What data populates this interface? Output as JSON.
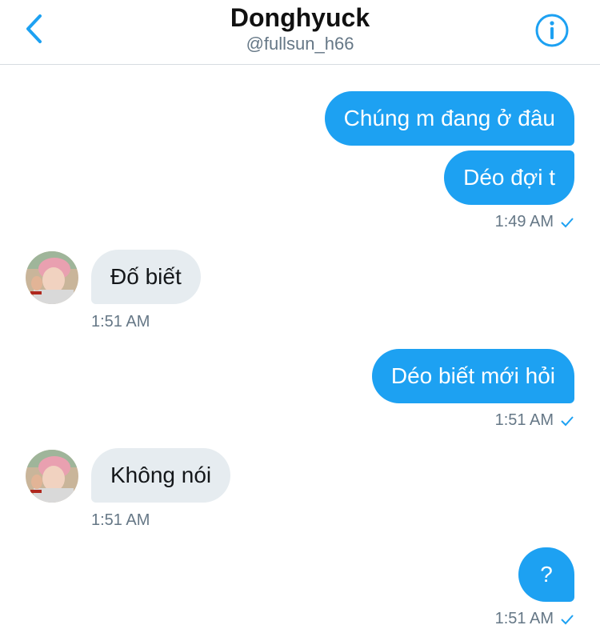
{
  "header": {
    "title": "Donghyuck",
    "handle": "@fullsun_h66"
  },
  "messages": [
    {
      "text": "Chúng m đang ở đâu"
    },
    {
      "text": "Déo đợi t",
      "time": "1:49 AM"
    },
    {
      "text": "Đố biết",
      "time": "1:51 AM"
    },
    {
      "text": "Déo biết mới hỏi",
      "time": "1:51 AM"
    },
    {
      "text": "Không nói",
      "time": "1:51 AM"
    },
    {
      "text": "?",
      "time": "1:51 AM"
    }
  ],
  "colors": {
    "accent": "#1da1f2",
    "incoming_bubble": "#e6ecf0",
    "meta_text": "#657786"
  }
}
